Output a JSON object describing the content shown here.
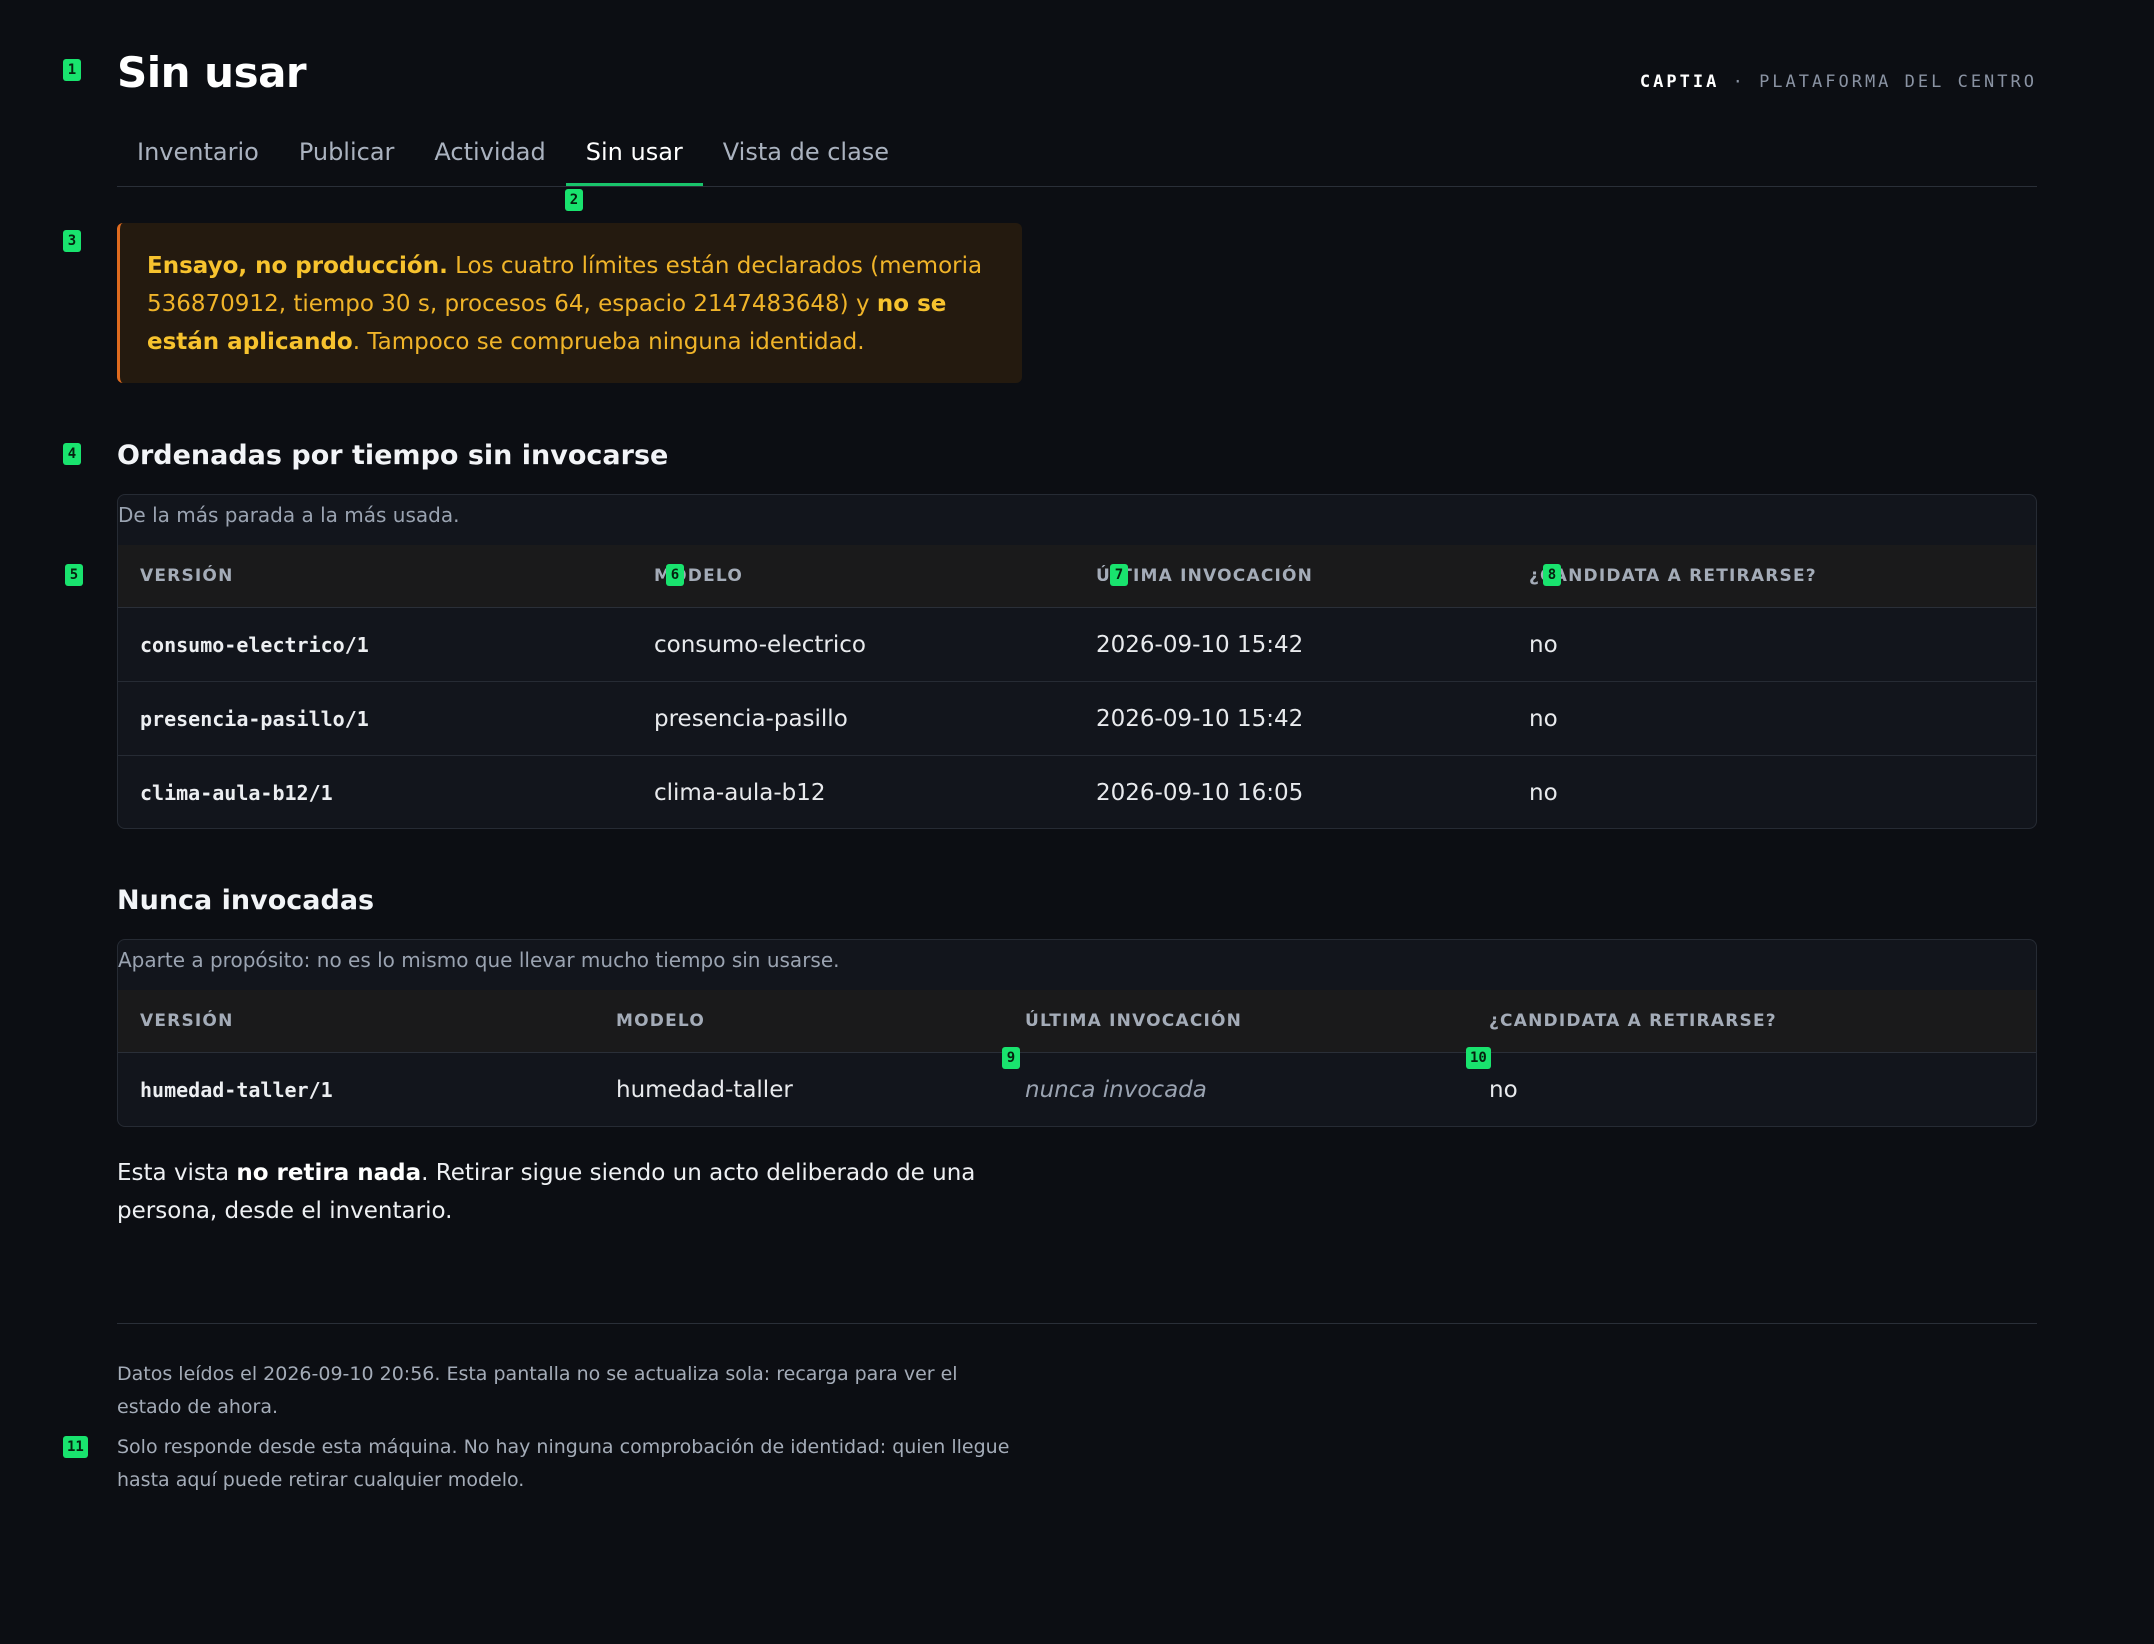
{
  "header": {
    "title": "Sin usar",
    "brand_name": "CAPTIA",
    "brand_separator": "·",
    "brand_suffix": "PLATAFORMA DEL CENTRO"
  },
  "tabs": [
    {
      "label": "Inventario",
      "active": false
    },
    {
      "label": "Publicar",
      "active": false
    },
    {
      "label": "Actividad",
      "active": false
    },
    {
      "label": "Sin usar",
      "active": true
    },
    {
      "label": "Vista de clase",
      "active": false
    }
  ],
  "warning": {
    "strong_lead": "Ensayo, no producción.",
    "text_1": " Los cuatro límites están declarados (memoria 536870912, tiempo 30 s, procesos 64, espacio 2147483648) y ",
    "strong_mid": "no se están aplicando",
    "text_2": ". Tampoco se comprueba ninguna identidad."
  },
  "sorted_section": {
    "title": "Ordenadas por tiempo sin invocarse",
    "caption": "De la más parada a la más usada.",
    "columns": [
      "VERSIÓN",
      "MODELO",
      "ÚLTIMA INVOCACIÓN",
      "¿CANDIDATA A RETIRARSE?"
    ],
    "rows": [
      {
        "version": "consumo-electrico/1",
        "model": "consumo-electrico",
        "last": "2026-09-10 15:42",
        "candidate": "no"
      },
      {
        "version": "presencia-pasillo/1",
        "model": "presencia-pasillo",
        "last": "2026-09-10 15:42",
        "candidate": "no"
      },
      {
        "version": "clima-aula-b12/1",
        "model": "clima-aula-b12",
        "last": "2026-09-10 16:05",
        "candidate": "no"
      }
    ]
  },
  "never_section": {
    "title": "Nunca invocadas",
    "caption": "Aparte a propósito: no es lo mismo que llevar mucho tiempo sin usarse.",
    "columns": [
      "VERSIÓN",
      "MODELO",
      "ÚLTIMA INVOCACIÓN",
      "¿CANDIDATA A RETIRARSE?"
    ],
    "rows": [
      {
        "version": "humedad-taller/1",
        "model": "humedad-taller",
        "last": "nunca invocada",
        "candidate": "no"
      }
    ]
  },
  "note": {
    "text_1": "Esta vista ",
    "strong": "no retira nada",
    "text_2": ". Retirar sigue siendo un acto deliberado de una persona, desde el inventario."
  },
  "footer": {
    "line_1": "Datos leídos el 2026-09-10 20:56. Esta pantalla no se actualiza sola: recarga para ver el estado de ahora.",
    "line_2": "Solo responde desde esta máquina. No hay ninguna comprobación de identidad: quien llegue hasta aquí puede retirar cualquier modelo."
  },
  "markers": [
    "1",
    "2",
    "3",
    "4",
    "5",
    "6",
    "7",
    "8",
    "9",
    "10",
    "11"
  ],
  "colors": {
    "background": "#0c0e13",
    "accent": "#19c46b",
    "marker": "#19e36e",
    "warning_text": "#f0b429",
    "warning_border": "#e06b1f"
  }
}
